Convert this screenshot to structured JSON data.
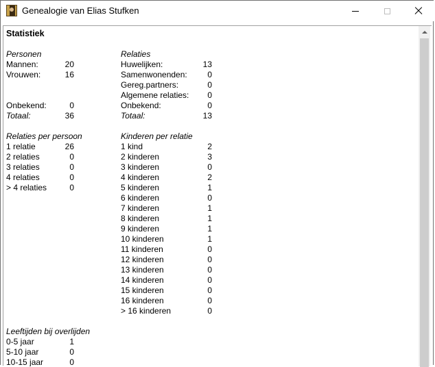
{
  "window": {
    "title": "Genealogie van Elias Stufken"
  },
  "heading": "Statistiek",
  "personen": {
    "title": "Personen",
    "rows": [
      {
        "label": "Mannen:",
        "value": "20"
      },
      {
        "label": "Vrouwen:",
        "value": "16"
      },
      {
        "label": "Onbekend:",
        "value": "0"
      }
    ],
    "total": {
      "label": "Totaal:",
      "value": "36"
    }
  },
  "relaties": {
    "title": "Relaties",
    "rows": [
      {
        "label": "Huwelijken:",
        "value": "13"
      },
      {
        "label": "Samenwonenden:",
        "value": "0"
      },
      {
        "label": "Gereg.partners:",
        "value": "0"
      },
      {
        "label": "Algemene relaties:",
        "value": "0"
      },
      {
        "label": "Onbekend:",
        "value": "0"
      }
    ],
    "total": {
      "label": "Totaal:",
      "value": "13"
    }
  },
  "relaties_per_persoon": {
    "title": "Relaties per persoon",
    "rows": [
      {
        "label": "1 relatie",
        "value": "26"
      },
      {
        "label": "2 relaties",
        "value": "0"
      },
      {
        "label": "3 relaties",
        "value": "0"
      },
      {
        "label": "4 relaties",
        "value": "0"
      },
      {
        "label": "> 4 relaties",
        "value": "0"
      }
    ]
  },
  "kinderen_per_relatie": {
    "title": "Kinderen per relatie",
    "rows": [
      {
        "label": "1 kind",
        "value": "2"
      },
      {
        "label": "2 kinderen",
        "value": "3"
      },
      {
        "label": "3 kinderen",
        "value": "0"
      },
      {
        "label": "4 kinderen",
        "value": "2"
      },
      {
        "label": "5 kinderen",
        "value": "1"
      },
      {
        "label": "6 kinderen",
        "value": "0"
      },
      {
        "label": "7 kinderen",
        "value": "1"
      },
      {
        "label": "8 kinderen",
        "value": "1"
      },
      {
        "label": "9 kinderen",
        "value": "1"
      },
      {
        "label": "10 kinderen",
        "value": "1"
      },
      {
        "label": "11 kinderen",
        "value": "0"
      },
      {
        "label": "12 kinderen",
        "value": "0"
      },
      {
        "label": "13 kinderen",
        "value": "0"
      },
      {
        "label": "14 kinderen",
        "value": "0"
      },
      {
        "label": "15 kinderen",
        "value": "0"
      },
      {
        "label": "16 kinderen",
        "value": "0"
      },
      {
        "label": "> 16 kinderen",
        "value": "0"
      }
    ]
  },
  "leeftijden": {
    "title": "Leeftijden bij overlijden",
    "rows": [
      {
        "label": "0-5 jaar",
        "value": "1"
      },
      {
        "label": "5-10 jaar",
        "value": "0"
      },
      {
        "label": "10-15 jaar",
        "value": "0"
      }
    ]
  }
}
